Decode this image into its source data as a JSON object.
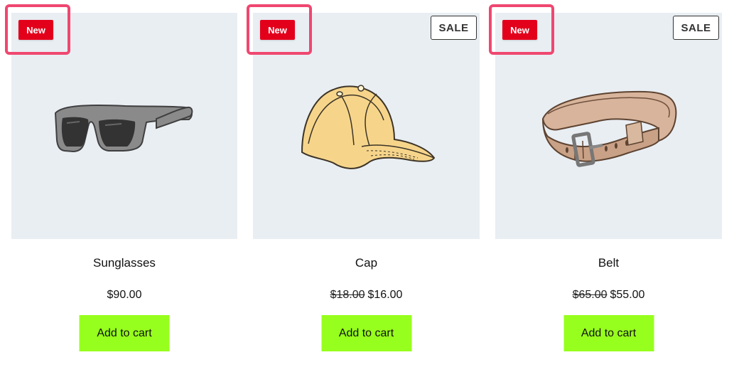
{
  "products": [
    {
      "name": "Sunglasses",
      "badge_new": "New",
      "price": "$90.00",
      "add_to_cart": "Add to cart",
      "image_icon": "sunglasses-icon"
    },
    {
      "name": "Cap",
      "badge_new": "New",
      "badge_sale": "SALE",
      "old_price": "$18.00",
      "price": "$16.00",
      "add_to_cart": "Add to cart",
      "image_icon": "cap-icon"
    },
    {
      "name": "Belt",
      "badge_new": "New",
      "badge_sale": "SALE",
      "old_price": "$65.00",
      "price": "$55.00",
      "add_to_cart": "Add to cart",
      "image_icon": "belt-icon"
    }
  ],
  "colors": {
    "new_badge": "#e3001b",
    "highlight_border": "#ef4770",
    "image_background": "#e9eef3",
    "cart_button": "#97ff1d"
  }
}
